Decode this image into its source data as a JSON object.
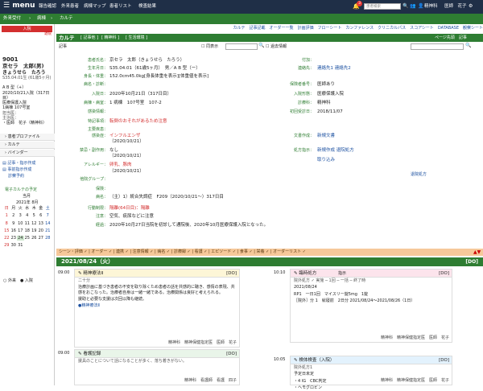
{
  "topbar": {
    "logo": "menu",
    "nav": [
      "報告確認",
      "外来患者",
      "病棟マップ",
      "患者リスト",
      "検査結果"
    ],
    "badge": "3",
    "search_placeholder": "患者検索",
    "user": "精神科",
    "doctor": "医師　花子"
  },
  "bar2": {
    "crumbs": [
      "外来受付",
      "病棟",
      "カルテ"
    ]
  },
  "patient": {
    "banner": "入院",
    "small_link": "退院",
    "id": "9001",
    "name": "京セラ　太郎(男)",
    "kana": "きょうせら　たろう",
    "dob": "S35.04.01生 (61歳5ヶ月)",
    "blood": "A B 型（+）",
    "admit": "2020/10/21入院（317日目）",
    "insurance": "医療保護入院",
    "room": "1病棟 107号室",
    "doctor_label": "担当医：",
    "nurse_label": "主治医：",
    "family": "・医師　花子（精神科）",
    "menus": [
      "患者プロファイル",
      "カルテ",
      "バインダー"
    ],
    "links": [
      "記事・指示作成",
      "事前指示作成",
      "診察予約"
    ],
    "calendar_title": "電子カルテの予定",
    "calendar_sub": "当月",
    "calendar_month": "2021年 8月",
    "weekdays": [
      "日",
      "月",
      "火",
      "水",
      "木",
      "金",
      "土"
    ],
    "days": [
      [
        "1",
        "2",
        "3",
        "4",
        "5",
        "6",
        "7"
      ],
      [
        "8",
        "9",
        "10",
        "11",
        "12",
        "13",
        "14"
      ],
      [
        "15",
        "16",
        "17",
        "18",
        "19",
        "20",
        "21"
      ],
      [
        "22",
        "23",
        "24",
        "25",
        "26",
        "27",
        "28"
      ],
      [
        "29",
        "30",
        "31",
        "",
        "",
        "",
        ""
      ]
    ],
    "legend": "○ 外来　● 入院"
  },
  "main": {
    "tabs": [
      "カルテ",
      "記事他",
      "精神科",
      "生活環境"
    ],
    "topright_links": [
      "カルテ",
      "記事記載",
      "オーダー一覧",
      "計画評価",
      "フローシート",
      "カンファレンス",
      "クリニカルパス",
      "スコアシート",
      "DATABASE",
      "観察シート"
    ],
    "page_title": "ページ先頭",
    "search_placeholder": "",
    "filter_label": "同表示",
    "filter2": "過去情報",
    "section_label": "記事",
    "fields": [
      {
        "label": "患者氏名：",
        "value": "京セラ　太郎（きょうせら　たろう）"
      },
      {
        "label": "生年月日：",
        "value": "S35.04.01（61歳5ヶ月）　男／A B 型（ー）"
      },
      {
        "label": "身長・体重：",
        "value": "152.0cm45.0kg[身長体重を表示][体重値を表示]"
      },
      {
        "label": "病名・診断：",
        "value": ""
      },
      {
        "label": "入院日：",
        "value": "2020年10月21日（317日目）"
      },
      {
        "label": "病棟・病室：",
        "value": "1 病棟　107号室　107-2"
      },
      {
        "label": "感染情報：",
        "value": ""
      },
      {
        "label": "特記事項：",
        "value": "転倒のおそれがあるため注意"
      },
      {
        "label": "主要疾患：",
        "value": ""
      },
      {
        "label": "感染症：",
        "value": "インフルエンザ"
      },
      {
        "label": "",
        "value": "（2020/10/21）"
      },
      {
        "label": "禁忌・副作用：",
        "value": "なし"
      },
      {
        "label": "",
        "value": "（2020/10/21）"
      },
      {
        "label": "アレルギー：",
        "value": "卵乳、豚肉"
      },
      {
        "label": "",
        "value": "（2020/10/21）"
      },
      {
        "label": "他院グループ：",
        "value": ""
      },
      {
        "label": "保険：",
        "value": ""
      },
      {
        "label": "病名：",
        "value": "（主）1）統合失調症　F209（2020/10/21～）317日目"
      },
      {
        "label": "行動制限：",
        "value": "隔離(64日目)：隔離"
      },
      {
        "label": "注意：",
        "value": "空気、痰尿などに注意"
      },
      {
        "label": "経過：",
        "value": "2020年10月27日当院を初診して通院後、2020年10月医療保護入院となった。"
      }
    ],
    "right_fields": [
      {
        "label": "付加：",
        "value": ""
      },
      {
        "label": "連絡先：",
        "value": "連絡先1 連絡先2"
      },
      {
        "label": "",
        "value": ""
      },
      {
        "label": "保険者番号：",
        "value": "医師あり"
      },
      {
        "label": "入院形態：",
        "value": "医療保護入院"
      },
      {
        "label": "診療科：",
        "value": "精神科"
      },
      {
        "label": "初回受診日：",
        "value": "2018/11/07"
      },
      {
        "label": "文書作成：",
        "value": "新規文書"
      },
      {
        "label": "処方指示：",
        "value": "新規作成  退院処方"
      },
      {
        "label": "",
        "value": "取り込み"
      }
    ],
    "orange_tabs": "シーン・評価 ✓ | オーダー ✓ | 連携 ✓ | 注意情報 ✓ | 病名 ✓ | 診療録 ✓ | 看護 ✓ | エピソード ✓ | 食事 ✓ | 栄養 ✓ | オーダーリスト ✓",
    "day_header": "2021/08/24（火）",
    "day_count": "[DO]"
  },
  "cards": [
    {
      "time": "09:00",
      "title": "精神療法Ⅱ",
      "tag": "[DO]",
      "body1": "二十分",
      "body2": "治療計画に基づき患者の不安を取り除くため患者の話を共感的に聴き、感情の表現、共感をおこなった。治療者自身は一緒一緒である。治療関係は良好と考えられる。",
      "body3": "援助と必要な支援は次回以降も継続。",
      "link": "●精神療法Ⅱ",
      "footer": "精神科　精神保健指定医　医師　花子"
    },
    {
      "time": "09:00",
      "title": "看護記録",
      "tag": "[DO]",
      "body1": "援具のことについて話になることが多く、落ち着きがない。",
      "footer": "精神科　看護師　看護　四子"
    },
    {
      "time": "10:10",
      "title": "臨時処方",
      "tag": "[DO]",
      "body1": "院外処方 ✓ 実施 ─ 1回 ─ 一括 ─ 終了時",
      "body2": "2021/08/24",
      "body3": "RP1　一日1回　マイスリー錠5mg　1錠",
      "body4": "［院外］分 1　就寝前　2日分 2021/08/24〜2021/08/26（1日）",
      "footer": "精神科　精神保健指定医　医師　花子"
    },
    {
      "time": "10:05",
      "title": "検体検査（入院）",
      "tag": "[DO]",
      "body1": "院外処方1",
      "body2": "予定日未定",
      "body3": "・4 IG　CBC判定",
      "body4": "・ヘモグロビン",
      "footer": "精神科　精神保健指定医　医師　花子"
    }
  ],
  "right_label": "指示",
  "right_label2": "指示",
  "footer_link": "ページ先頭　記事"
}
